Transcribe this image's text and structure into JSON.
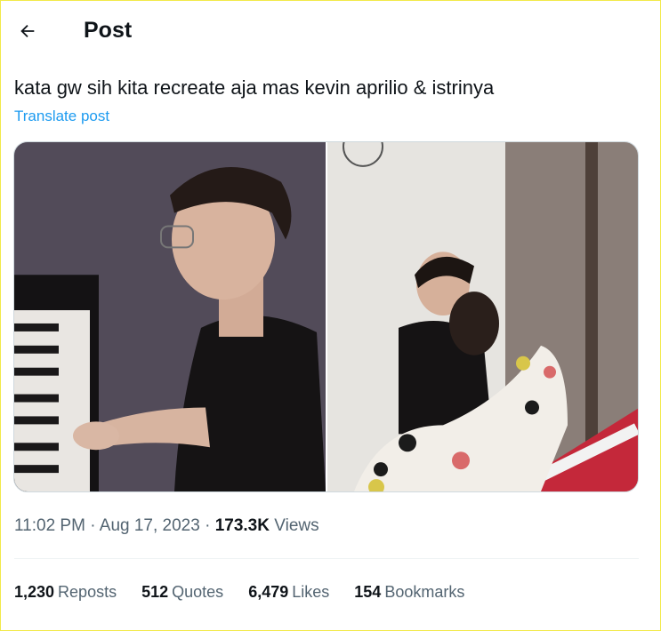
{
  "header": {
    "title": "Post",
    "back_icon": "arrow-left-icon"
  },
  "post": {
    "text": "kata gw sih kita recreate aja mas kevin aprilio & istrinya",
    "translate_label": "Translate post",
    "media": [
      {
        "description_icon": "photo-man-playing-piano"
      },
      {
        "description_icon": "photo-couple-at-red-piano"
      }
    ],
    "time": "11:02 PM",
    "date": "Aug 17, 2023",
    "views_count": "173.3K",
    "views_label": "Views",
    "separator": "·"
  },
  "stats": {
    "reposts_count": "1,230",
    "reposts_label": "Reposts",
    "quotes_count": "512",
    "quotes_label": "Quotes",
    "likes_count": "6,479",
    "likes_label": "Likes",
    "bookmarks_count": "154",
    "bookmarks_label": "Bookmarks"
  },
  "colors": {
    "link": "#1d9bf0",
    "text": "#0f1419",
    "muted": "#536471",
    "accent_border": "#f2ea4a"
  }
}
